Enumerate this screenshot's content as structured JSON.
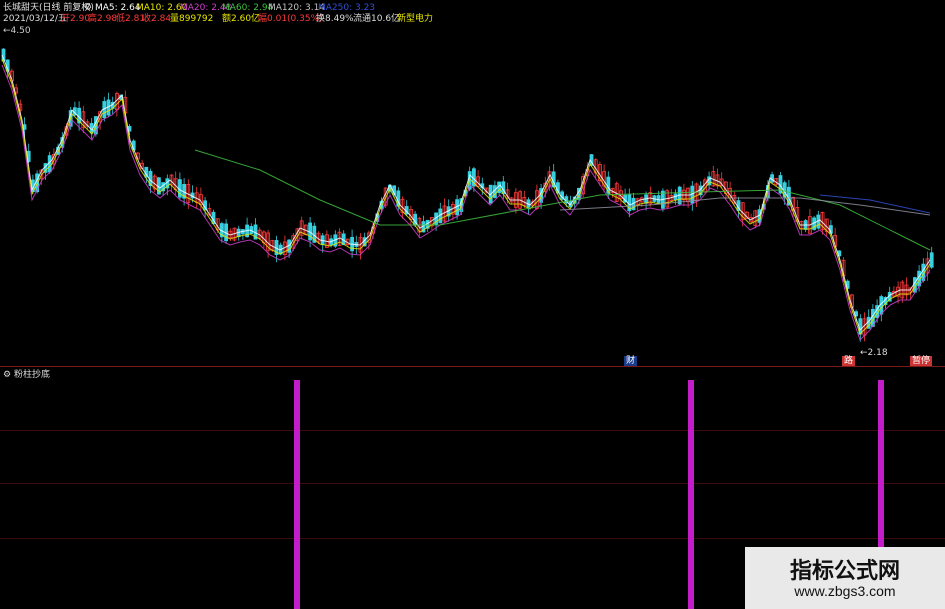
{
  "header": {
    "title": "长城甜天(日线 前复权)",
    "ma5": "MA5: 2.64",
    "ma10": "MA10: 2.60",
    "ma20": "MA20: 2.48",
    "ma60": "MA60: 2.94",
    "ma120": "MA120: 3.14",
    "ma250": "MA250: 3.23",
    "price_high_label": "4.50",
    "row2": {
      "date": "2021/03/12/五",
      "open": "开2.90",
      "high": "高2.98",
      "low": "低2.81",
      "close": "收2.84",
      "volume": "量899792",
      "amount": "额2.60亿",
      "change": "幅0.01(0.35%)",
      "turnover": "换8.49%",
      "float": "流通10.6亿",
      "concept": "新型电力"
    }
  },
  "main_chart": {
    "low_label": "2.18",
    "markers": [
      {
        "label": "财"
      },
      {
        "label": "路"
      },
      {
        "label": "暂停"
      }
    ]
  },
  "indicator": {
    "name": "粉柱抄底"
  },
  "watermark": {
    "title": "指标公式网",
    "url": "www.zbgs3.com"
  },
  "colors": {
    "up": "#ff3a3a",
    "down": "#36d0e0",
    "ma5": "#ffffff",
    "ma10": "#e6e600",
    "ma20": "#d040d0",
    "ma60": "#40c040",
    "ma120": "#9090a0",
    "ma250": "#3050d0",
    "signal_bar": "#c21dc9"
  },
  "chart_data": {
    "type": "candlestick",
    "ylim": [
      2.18,
      4.5
    ],
    "ma_series": [
      "MA5",
      "MA10",
      "MA20",
      "MA60",
      "MA120",
      "MA250"
    ],
    "indicator_signals": [
      "粉柱",
      "粉柱",
      "粉柱"
    ]
  }
}
